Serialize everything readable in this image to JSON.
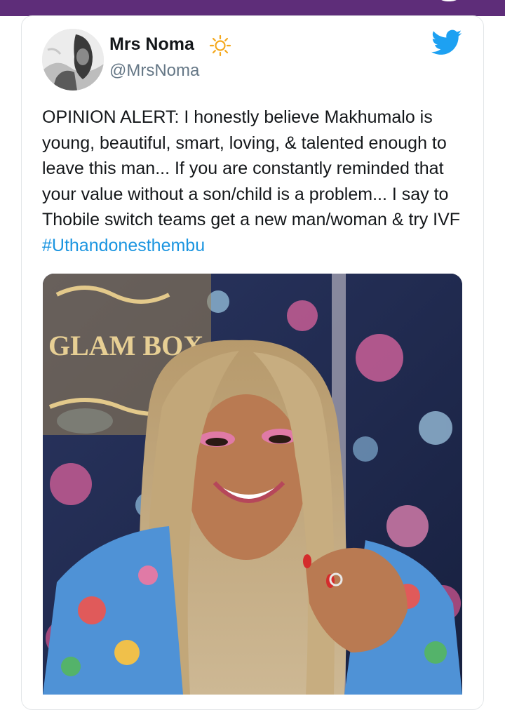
{
  "tweet": {
    "author": {
      "display_name": "Mrs Noma",
      "handle": "@MrsNoma",
      "name_emoji": "sun-icon"
    },
    "text": "OPINION ALERT: I honestly believe Makhumalo is young, beautiful, smart, loving, & talented enough to leave this man... If you are constantly reminded that your value without a son/child is a problem... I say to Thobile switch teams get a new man/woman & try IVF ",
    "hashtag": "#Uthandonesthembu",
    "media": {
      "sign_text": "GLAM BOX",
      "description_icon": "photo"
    }
  },
  "colors": {
    "top_bar": "#5e2d79",
    "hashtag": "#1b95e0",
    "twitter_blue": "#1da1f2",
    "handle_gray": "#657786",
    "card_border": "#e3e6e8"
  },
  "icons": [
    "twitter-bird-icon",
    "sun-icon",
    "avatar"
  ]
}
